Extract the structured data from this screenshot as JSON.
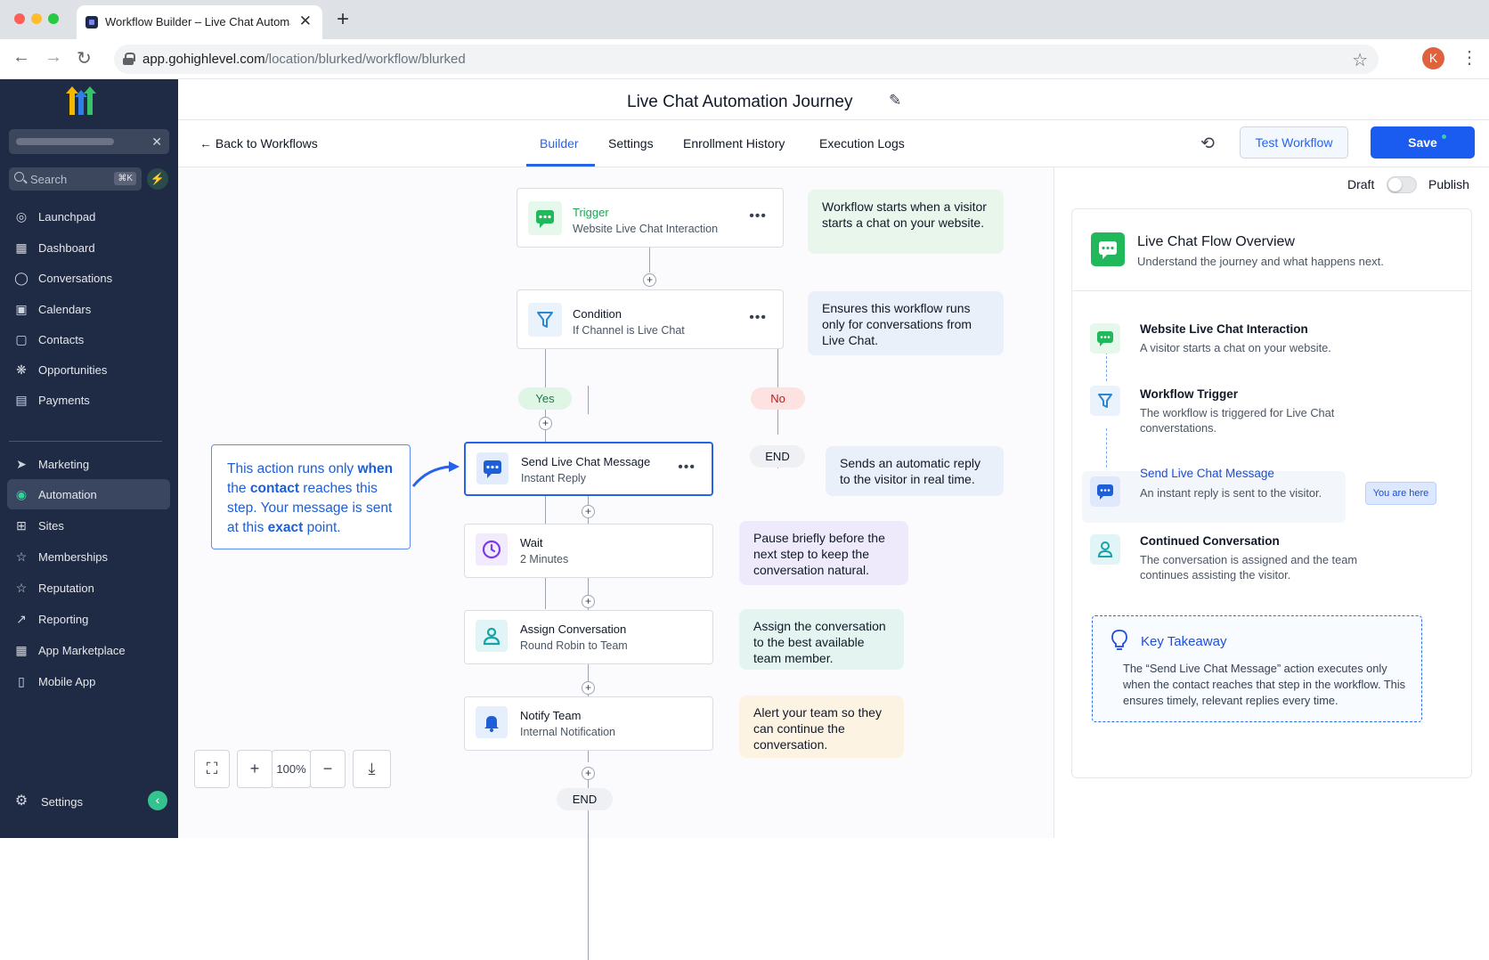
{
  "browser": {
    "tab_title": "Workflow Builder – Live Chat Automation Journey",
    "url_host": "app.gohighlevel.com",
    "url_path": "/location/blurked/workflow/blurked",
    "avatar_letter": "K"
  },
  "sidebar": {
    "search_placeholder": "Search",
    "search_shortcut": "⌘K",
    "items": [
      {
        "label": "Launchpad",
        "icon": "rocket-icon"
      },
      {
        "label": "Dashboard",
        "icon": "grid-icon"
      },
      {
        "label": "Conversations",
        "icon": "chat-icon"
      },
      {
        "label": "Calendars",
        "icon": "calendar-icon"
      },
      {
        "label": "Contacts",
        "icon": "contacts-icon"
      },
      {
        "label": "Opportunities",
        "icon": "network-icon"
      },
      {
        "label": "Payments",
        "icon": "receipt-icon"
      },
      {
        "label": "Marketing",
        "icon": "send-icon"
      },
      {
        "label": "Automation",
        "icon": "automation-icon"
      },
      {
        "label": "Sites",
        "icon": "sites-icon"
      },
      {
        "label": "Memberships",
        "icon": "star-icon"
      },
      {
        "label": "Reputation",
        "icon": "star-outline-icon"
      },
      {
        "label": "Reporting",
        "icon": "trend-icon"
      },
      {
        "label": "App Marketplace",
        "icon": "apps-icon"
      },
      {
        "label": "Mobile App",
        "icon": "phone-icon"
      }
    ],
    "settings_label": "Settings",
    "active": "Automation"
  },
  "header": {
    "title": "Live Chat Automation Journey",
    "back_label": "Back to Workflows",
    "tabs": [
      "Builder",
      "Settings",
      "Enrollment History",
      "Execution Logs"
    ],
    "active_tab": "Builder",
    "test_label": "Test Workflow",
    "save_label": "Save"
  },
  "canvas": {
    "trigger": {
      "title": "Trigger",
      "subtitle": "Website Live Chat Interaction",
      "note": "Workflow starts when a visitor starts a chat on your website."
    },
    "condition": {
      "title": "Condition",
      "subtitle": "If Channel is Live Chat",
      "note": "Ensures this workflow runs only for conversations from Live Chat."
    },
    "yes_label": "Yes",
    "no_label": "No",
    "end_label": "END",
    "send": {
      "title": "Send Live Chat Message",
      "subtitle": "Instant Reply",
      "note": "Sends an automatic reply to the visitor in real time."
    },
    "wait": {
      "title": "Wait",
      "subtitle": "2 Minutes",
      "note": "Pause briefly before the next step to keep the conversation natural."
    },
    "assign": {
      "title": "Assign Conversation",
      "subtitle": "Round Robin to Team",
      "note": "Assign the conversation to the best available team member."
    },
    "notify": {
      "title": "Notify Team",
      "subtitle": "Internal Notification",
      "note": "Alert your team so they can continue the conversation."
    },
    "callout": {
      "t1": "This action runs only ",
      "b1": "when",
      "t2": " the ",
      "b2": "contact",
      "t3": " reaches this step. Your message is sent at this ",
      "b3": "exact",
      "t4": " point."
    },
    "zoom": "100%"
  },
  "panel": {
    "draft_label": "Draft",
    "publish_label": "Publish",
    "title": "Live Chat Flow Overview",
    "subtitle": "Understand the journey and what happens next.",
    "steps": [
      {
        "title": "Website Live Chat Interaction",
        "desc": "A visitor starts a chat on your website."
      },
      {
        "title": "Workflow Trigger",
        "desc": "The workflow is triggered for Live Chat converstations."
      },
      {
        "title": "Send Live Chat Message",
        "desc": "An instant reply is sent to the visitor."
      },
      {
        "title": "Continued Conversation",
        "desc": "The conversation is assigned and the team continues assisting the visitor."
      }
    ],
    "here_label": "You are here",
    "takeaway_title": "Key Takeaway",
    "takeaway_body": "The “Send Live Chat Message” action executes only when the contact reaches that step in the workflow. This ensures timely, relevant replies every time."
  },
  "colors": {
    "sidebar_bg": "#1f2a44",
    "primary": "#1a5bf0",
    "trigger_green": "#21b85b",
    "condition_blue": "#2b87d1",
    "wait_purple": "#7c3aed",
    "assign_teal": "#14a3a8"
  }
}
